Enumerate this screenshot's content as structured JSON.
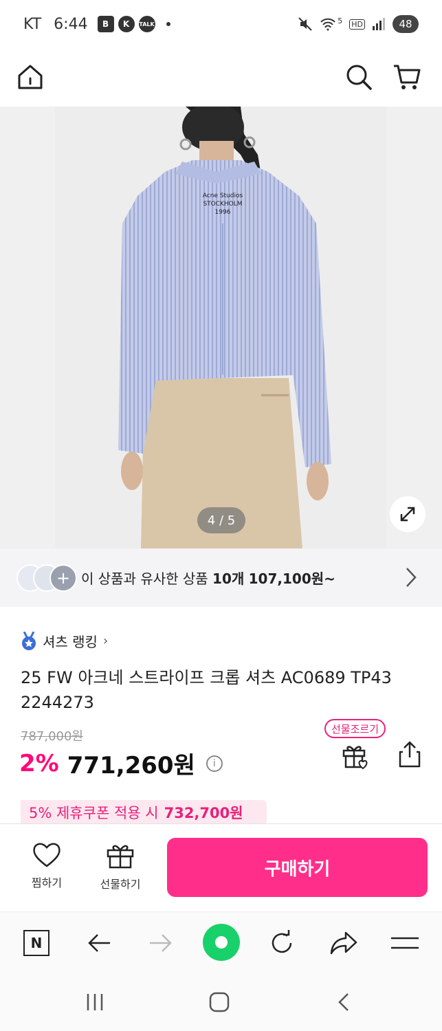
{
  "status_bar": {
    "carrier": "KT",
    "time": "6:44",
    "apps": [
      "B",
      "K",
      "TALK"
    ],
    "network": "5",
    "hd": "HD",
    "battery": "48"
  },
  "header": {
    "icons": [
      "home-icon",
      "search-icon",
      "cart-icon"
    ]
  },
  "gallery": {
    "counter": "4 / 5",
    "print_lines": [
      "Acne Studios",
      "STOCKHOLM",
      "1996"
    ]
  },
  "similar": {
    "prefix": "이 상품과 유사한 상품",
    "count": "10개",
    "price": "107,100원~"
  },
  "product": {
    "ranking": "셔츠 랭킹",
    "title": "25 FW 아크네 스트라이프 크롭 셔츠 AC0689 TP43 2244273",
    "original_price": "787,000원",
    "discount": "2%",
    "price": "771,260원",
    "gift_tag": "선물조르기",
    "coupon_prefix": "5% 제휴쿠폰 적용 시",
    "coupon_price": "732,700원"
  },
  "actions": {
    "wish_label": "찜하기",
    "gift_label": "선물하기",
    "buy_label": "구매하기"
  },
  "browser_bar": {
    "n_label": "N"
  },
  "colors": {
    "accent": "#ff2e8b",
    "discount": "#ff0a7a",
    "coupon_bg": "#fde8f0",
    "shirt": "#b7c1e2"
  }
}
